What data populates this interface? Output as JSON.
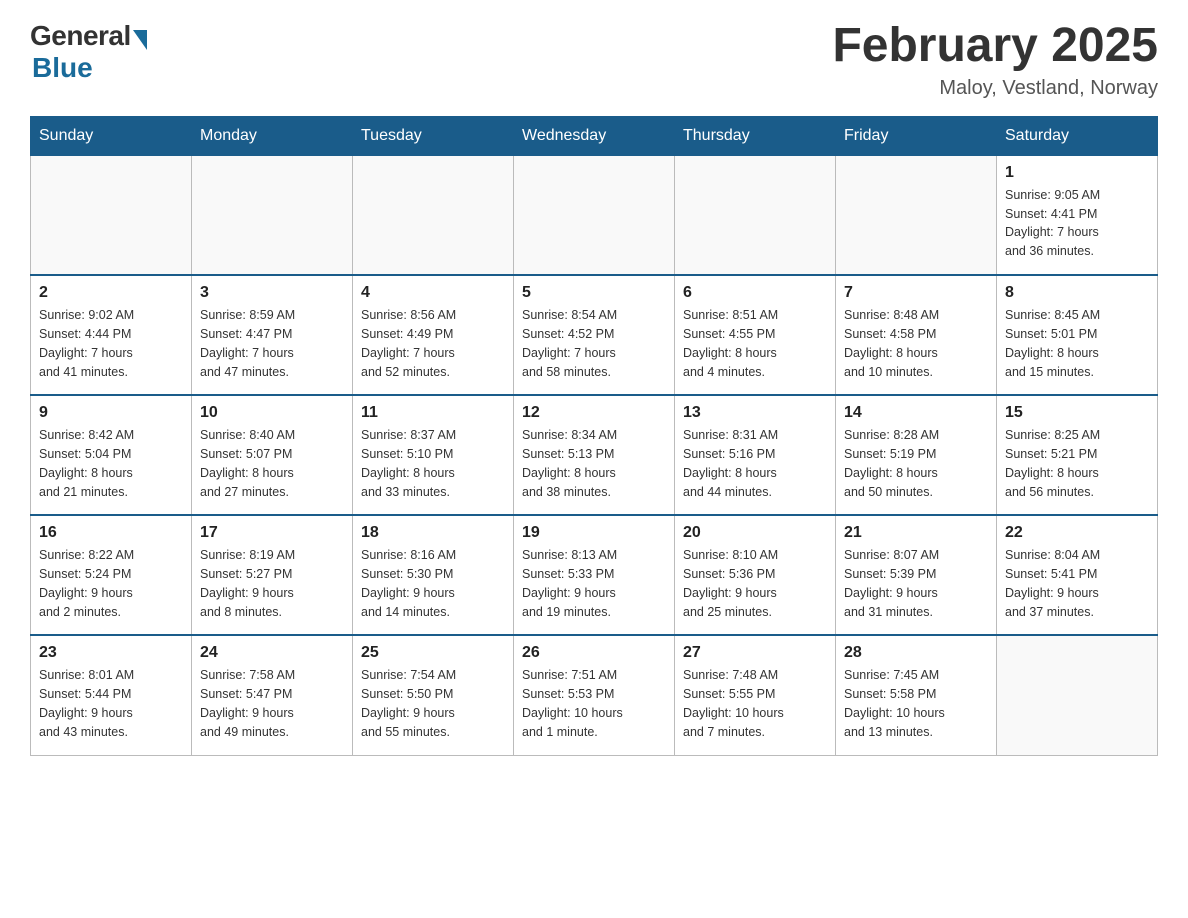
{
  "header": {
    "logo_general": "General",
    "logo_blue": "Blue",
    "title": "February 2025",
    "subtitle": "Maloy, Vestland, Norway"
  },
  "days_of_week": [
    "Sunday",
    "Monday",
    "Tuesday",
    "Wednesday",
    "Thursday",
    "Friday",
    "Saturday"
  ],
  "weeks": [
    [
      {
        "day": "",
        "info": ""
      },
      {
        "day": "",
        "info": ""
      },
      {
        "day": "",
        "info": ""
      },
      {
        "day": "",
        "info": ""
      },
      {
        "day": "",
        "info": ""
      },
      {
        "day": "",
        "info": ""
      },
      {
        "day": "1",
        "info": "Sunrise: 9:05 AM\nSunset: 4:41 PM\nDaylight: 7 hours\nand 36 minutes."
      }
    ],
    [
      {
        "day": "2",
        "info": "Sunrise: 9:02 AM\nSunset: 4:44 PM\nDaylight: 7 hours\nand 41 minutes."
      },
      {
        "day": "3",
        "info": "Sunrise: 8:59 AM\nSunset: 4:47 PM\nDaylight: 7 hours\nand 47 minutes."
      },
      {
        "day": "4",
        "info": "Sunrise: 8:56 AM\nSunset: 4:49 PM\nDaylight: 7 hours\nand 52 minutes."
      },
      {
        "day": "5",
        "info": "Sunrise: 8:54 AM\nSunset: 4:52 PM\nDaylight: 7 hours\nand 58 minutes."
      },
      {
        "day": "6",
        "info": "Sunrise: 8:51 AM\nSunset: 4:55 PM\nDaylight: 8 hours\nand 4 minutes."
      },
      {
        "day": "7",
        "info": "Sunrise: 8:48 AM\nSunset: 4:58 PM\nDaylight: 8 hours\nand 10 minutes."
      },
      {
        "day": "8",
        "info": "Sunrise: 8:45 AM\nSunset: 5:01 PM\nDaylight: 8 hours\nand 15 minutes."
      }
    ],
    [
      {
        "day": "9",
        "info": "Sunrise: 8:42 AM\nSunset: 5:04 PM\nDaylight: 8 hours\nand 21 minutes."
      },
      {
        "day": "10",
        "info": "Sunrise: 8:40 AM\nSunset: 5:07 PM\nDaylight: 8 hours\nand 27 minutes."
      },
      {
        "day": "11",
        "info": "Sunrise: 8:37 AM\nSunset: 5:10 PM\nDaylight: 8 hours\nand 33 minutes."
      },
      {
        "day": "12",
        "info": "Sunrise: 8:34 AM\nSunset: 5:13 PM\nDaylight: 8 hours\nand 38 minutes."
      },
      {
        "day": "13",
        "info": "Sunrise: 8:31 AM\nSunset: 5:16 PM\nDaylight: 8 hours\nand 44 minutes."
      },
      {
        "day": "14",
        "info": "Sunrise: 8:28 AM\nSunset: 5:19 PM\nDaylight: 8 hours\nand 50 minutes."
      },
      {
        "day": "15",
        "info": "Sunrise: 8:25 AM\nSunset: 5:21 PM\nDaylight: 8 hours\nand 56 minutes."
      }
    ],
    [
      {
        "day": "16",
        "info": "Sunrise: 8:22 AM\nSunset: 5:24 PM\nDaylight: 9 hours\nand 2 minutes."
      },
      {
        "day": "17",
        "info": "Sunrise: 8:19 AM\nSunset: 5:27 PM\nDaylight: 9 hours\nand 8 minutes."
      },
      {
        "day": "18",
        "info": "Sunrise: 8:16 AM\nSunset: 5:30 PM\nDaylight: 9 hours\nand 14 minutes."
      },
      {
        "day": "19",
        "info": "Sunrise: 8:13 AM\nSunset: 5:33 PM\nDaylight: 9 hours\nand 19 minutes."
      },
      {
        "day": "20",
        "info": "Sunrise: 8:10 AM\nSunset: 5:36 PM\nDaylight: 9 hours\nand 25 minutes."
      },
      {
        "day": "21",
        "info": "Sunrise: 8:07 AM\nSunset: 5:39 PM\nDaylight: 9 hours\nand 31 minutes."
      },
      {
        "day": "22",
        "info": "Sunrise: 8:04 AM\nSunset: 5:41 PM\nDaylight: 9 hours\nand 37 minutes."
      }
    ],
    [
      {
        "day": "23",
        "info": "Sunrise: 8:01 AM\nSunset: 5:44 PM\nDaylight: 9 hours\nand 43 minutes."
      },
      {
        "day": "24",
        "info": "Sunrise: 7:58 AM\nSunset: 5:47 PM\nDaylight: 9 hours\nand 49 minutes."
      },
      {
        "day": "25",
        "info": "Sunrise: 7:54 AM\nSunset: 5:50 PM\nDaylight: 9 hours\nand 55 minutes."
      },
      {
        "day": "26",
        "info": "Sunrise: 7:51 AM\nSunset: 5:53 PM\nDaylight: 10 hours\nand 1 minute."
      },
      {
        "day": "27",
        "info": "Sunrise: 7:48 AM\nSunset: 5:55 PM\nDaylight: 10 hours\nand 7 minutes."
      },
      {
        "day": "28",
        "info": "Sunrise: 7:45 AM\nSunset: 5:58 PM\nDaylight: 10 hours\nand 13 minutes."
      },
      {
        "day": "",
        "info": ""
      }
    ]
  ]
}
